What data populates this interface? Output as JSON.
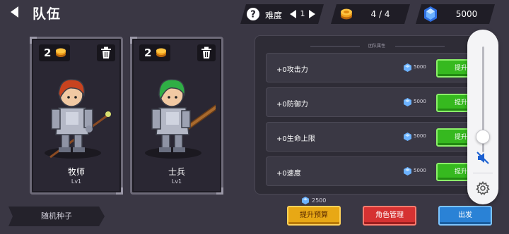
{
  "header": {
    "title": "队伍",
    "difficulty_label": "难度",
    "difficulty_value": "1",
    "coins": "4 / 4",
    "gems": "5000"
  },
  "heroes": [
    {
      "name": "牧师",
      "level": "Lv1",
      "cost": "2",
      "hair_color": "#c8431f",
      "weapon": "staff"
    },
    {
      "name": "士兵",
      "level": "Lv1",
      "cost": "2",
      "hair_color": "#2fae45",
      "weapon": "sword"
    }
  ],
  "random_seed_label": "随机种子",
  "team_panel": {
    "heading": "团队属性",
    "stats": [
      {
        "label": "+0攻击力",
        "cost": "5000",
        "button": "提升"
      },
      {
        "label": "+0防御力",
        "cost": "5000",
        "button": "提升"
      },
      {
        "label": "+0生命上限",
        "cost": "5000",
        "button": "提升"
      },
      {
        "label": "+0速度",
        "cost": "5000",
        "button": "提升"
      }
    ]
  },
  "budget_cost": "2500",
  "actions": {
    "budget": "提升预算",
    "roles": "角色管理",
    "depart": "出发"
  },
  "volume": {
    "level": 0.15,
    "muted": true
  },
  "colors": {
    "background": "#3a3744",
    "upgrade_green": "#36b91f",
    "budget_orange": "#e8a815",
    "roles_red": "#d63232",
    "depart_blue": "#2a82d6",
    "gem_blue": "#3f8cff",
    "coin_orange": "#f0a01c"
  }
}
